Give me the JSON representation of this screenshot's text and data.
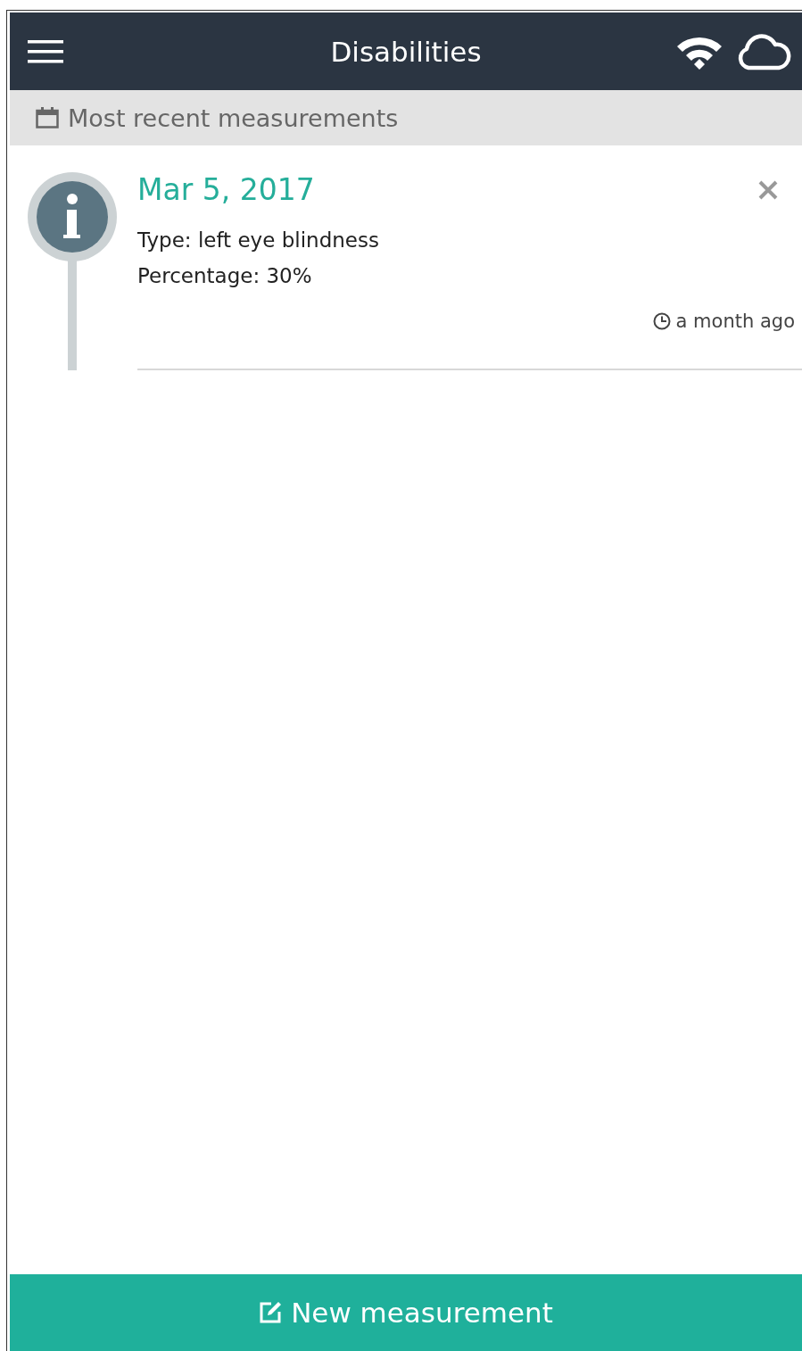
{
  "header": {
    "title": "Disabilities"
  },
  "section": {
    "title": "Most recent measurements"
  },
  "entries": [
    {
      "date": "Mar 5, 2017",
      "lines": [
        "Type: left eye blindness",
        "Percentage: 30%"
      ],
      "time": "a month ago"
    }
  ],
  "button": {
    "label": "New measurement"
  }
}
